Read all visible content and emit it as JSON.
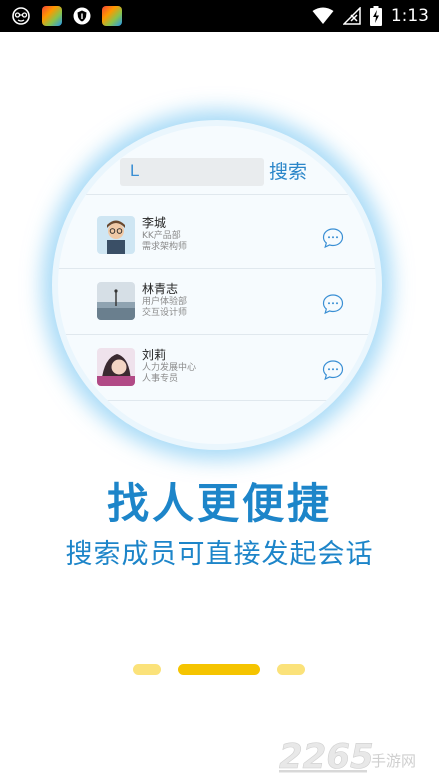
{
  "status_bar": {
    "time": "1:13",
    "icons": [
      "face-icon",
      "app-icon",
      "shield-icon",
      "app-icon",
      "wifi-icon",
      "signal-icon",
      "battery-charging-icon"
    ]
  },
  "preview": {
    "search": {
      "value": "L",
      "button_label": "搜索"
    },
    "contacts": [
      {
        "name": "李城",
        "dept": "KK产品部",
        "title": "需求架构师"
      },
      {
        "name": "林青志",
        "dept": "用户体验部",
        "title": "交互设计师"
      },
      {
        "name": "刘莉",
        "dept": "人力发展中心",
        "title": "人事专员"
      }
    ]
  },
  "headline": "找人更便捷",
  "subline": "搜索成员可直接发起会话",
  "pager": {
    "count": 3,
    "active_index": 1
  },
  "watermark": {
    "brand": "2265",
    "sub": "手游网"
  },
  "colors": {
    "accent": "#1d85c9",
    "pager_active": "#f5c400",
    "pager_inactive": "#fbe27a"
  }
}
